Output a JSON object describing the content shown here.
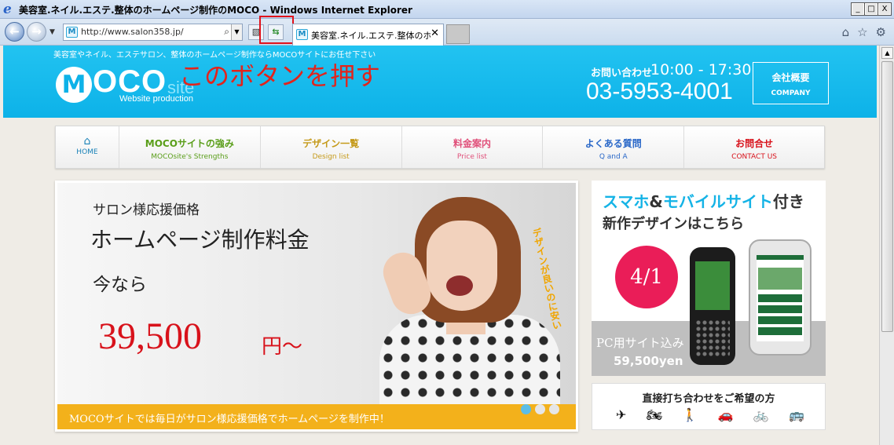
{
  "window": {
    "title": "美容室.ネイル.エステ.整体のホームページ制作のMOCO - Windows Internet Explorer",
    "ie_logo": "e",
    "btn_minimize": "_",
    "btn_maximize": "□",
    "btn_close": "X"
  },
  "toolbar": {
    "back": "←",
    "forward": "→",
    "history_dropdown": "▼",
    "favicon_glyph": "M",
    "url": "http://www.salon358.jp/",
    "search_glyph": "⌕",
    "address_dropdown": "▼",
    "compat_glyph": "▧",
    "refresh_glyph": "⇆",
    "tab_title": "美容室.ネイル.エステ.整体のホ...",
    "tab_close": "✕",
    "home_glyph": "⌂",
    "favorites_glyph": "☆",
    "tools_glyph": "⚙"
  },
  "annotation": {
    "text": "このボタンを押す",
    "color": "#e0121b"
  },
  "header": {
    "tagline": "美容室やネイル、エステサロン、整体のホームページ制作ならMOCOサイトにお任せ下さい",
    "logo_mark": "M",
    "logo_text": "OCO",
    "logo_site": "site",
    "logo_sub": "Website production",
    "phone_label": "お問い合わせ",
    "phone_hours": "10:00 - 17:30",
    "phone_number": "03-5953-4001",
    "company_jp": "会社概要",
    "company_en": "COMPANY",
    "bg_color": "#0db2e8"
  },
  "menu": {
    "home_glyph": "⌂",
    "home_label": "HOME",
    "items": [
      {
        "jp": "MOCOサイトの強み",
        "en": "MOCOsite's Strengths",
        "color": "#5a9e1a"
      },
      {
        "jp": "デザイン一覧",
        "en": "Design list",
        "color": "#c59a1a"
      },
      {
        "jp": "料金案内",
        "en": "Price list",
        "color": "#e0507a"
      },
      {
        "jp": "よくある質問",
        "en": "Q and A",
        "color": "#2a68c8"
      },
      {
        "jp": "お問合せ",
        "en": "CONTACT US",
        "color": "#d8121b"
      }
    ]
  },
  "banner": {
    "line1": "サロン様応援価格",
    "line2": "ホームページ制作料金",
    "line3": "今なら",
    "price": "39,500",
    "unit": "円～",
    "callout": "デザインが良いのに安い",
    "footer": "MOCOサイトでは毎日がサロン様応援価格でホームページを制作中！",
    "slides_total": 3,
    "slide_active": 1
  },
  "promo": {
    "line1_a": "スマホ",
    "line1_amp": "&",
    "line1_b": "モバイルサイト",
    "line1_c": "付き",
    "line2": "新作デザインはこちら",
    "date": "4/1",
    "pc_label": "PC用サイト込み",
    "price": "59,500yen"
  },
  "contact": {
    "title": "直接打ち合わせをご希望の方",
    "icons": [
      "airplane-icon",
      "motorcycle-icon",
      "walking-icon",
      "car-icon",
      "bicycle-icon",
      "bus-icon"
    ],
    "glyphs": [
      "✈",
      "🏍",
      "🚶",
      "🚗",
      "🚲",
      "🚌"
    ]
  }
}
